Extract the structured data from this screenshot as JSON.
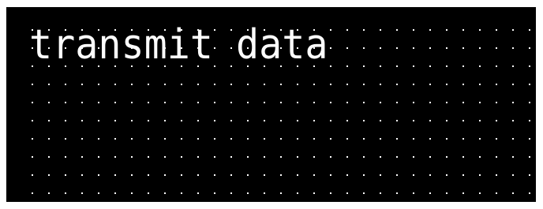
{
  "display": {
    "text": "transmit data",
    "background_color": "#000000",
    "text_color": "#ffffff",
    "dot_color": "#ffffff"
  }
}
